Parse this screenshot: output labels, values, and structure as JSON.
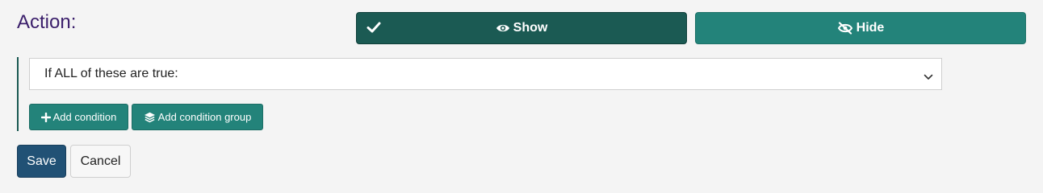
{
  "action": {
    "label": "Action:",
    "show_label": "Show",
    "hide_label": "Hide",
    "selected": "Show"
  },
  "condition_group": {
    "select_value": "If ALL of these are true:",
    "add_condition_label": "Add condition",
    "add_condition_group_label": "Add condition group"
  },
  "footer": {
    "save_label": "Save",
    "cancel_label": "Cancel"
  },
  "icons": {
    "check": "check-icon",
    "show": "eye-icon",
    "hide": "eye-slash-icon",
    "chevron": "chevron-down-icon",
    "add": "plus-icon",
    "group": "layers-icon"
  },
  "colors": {
    "show_selected": "#1b5a53",
    "hide_button": "#23837a",
    "secondary_button": "#23837a",
    "save_button": "#215175",
    "action_label": "#3b1f6b"
  }
}
